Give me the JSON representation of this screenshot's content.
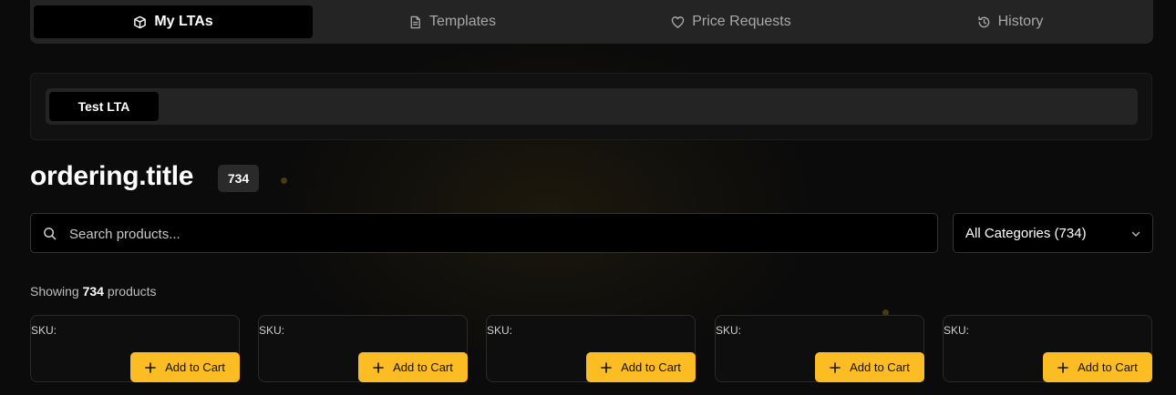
{
  "tabs": [
    {
      "label": "My LTAs",
      "icon": "box-icon",
      "active": true
    },
    {
      "label": "Templates",
      "icon": "document-icon",
      "active": false
    },
    {
      "label": "Price Requests",
      "icon": "heart-icon",
      "active": false
    },
    {
      "label": "History",
      "icon": "history-icon",
      "active": false
    }
  ],
  "lta": {
    "selected": "Test LTA"
  },
  "page": {
    "title": "ordering.title",
    "count": "734"
  },
  "search": {
    "placeholder": "Search products...",
    "value": ""
  },
  "category_filter": {
    "selected": "All Categories (734)"
  },
  "showing": {
    "prefix": "Showing",
    "count": "734",
    "suffix": "products"
  },
  "products": [
    {
      "sku_label": "SKU:",
      "add_label": "Add to Cart"
    },
    {
      "sku_label": "SKU:",
      "add_label": "Add to Cart"
    },
    {
      "sku_label": "SKU:",
      "add_label": "Add to Cart"
    },
    {
      "sku_label": "SKU:",
      "add_label": "Add to Cart"
    },
    {
      "sku_label": "SKU:",
      "add_label": "Add to Cart"
    }
  ],
  "colors": {
    "accent": "#fbbd23",
    "background": "#0b0b0b",
    "tab_bar": "#242424"
  }
}
